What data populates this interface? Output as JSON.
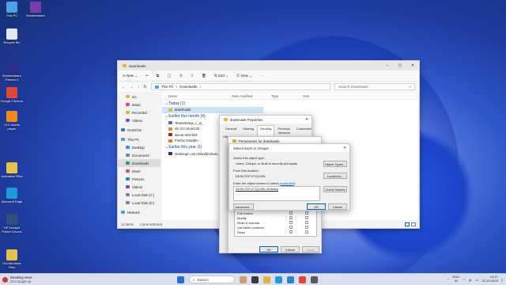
{
  "desktop": {
    "icons": [
      {
        "label": "This PC",
        "color": "#4d9fe8"
      },
      {
        "label": "Recycle Bin",
        "color": "#dfe8f3"
      },
      {
        "label": "Wondershare Filmora X",
        "color": "#2d2d8c"
      },
      {
        "label": "Google Chrome",
        "color": "#e2463b"
      },
      {
        "label": "VLC media player",
        "color": "#f08a1c"
      },
      {
        "label": "Activation Files",
        "color": "#e7c24a"
      },
      {
        "label": "Microsoft Edge",
        "color": "#1d9bd8"
      },
      {
        "label": "HP Deskjet Printer Drivers",
        "color": "#305080"
      },
      {
        "label": "Old Windows Files",
        "color": "#e7c24a"
      },
      {
        "label": "Wondershare",
        "color": "#7a3db0"
      }
    ]
  },
  "explorer": {
    "title": "downloads",
    "new_label": "New",
    "sort_label": "Sort",
    "view_label": "View",
    "breadcrumb": [
      "This PC",
      "Downloads"
    ],
    "search_placeholder": "Search Downloads",
    "columns": [
      "Name",
      "Date modified",
      "Type",
      "Size"
    ],
    "nav": [
      {
        "label": "etc",
        "icon": "#e2b341"
      },
      {
        "label": "Music",
        "icon": "#e0457b"
      },
      {
        "label": "Recorded",
        "icon": "#e2b341"
      },
      {
        "label": "Videos",
        "icon": "#7d4ad6"
      },
      {
        "label": "OneDrive",
        "icon": "#2e7dd7"
      },
      {
        "label": "This PC",
        "icon": "#4d9fe8"
      },
      {
        "label": "Desktop",
        "icon": "#3a8ee6"
      },
      {
        "label": "Documents",
        "icon": "#6f8aa8"
      },
      {
        "label": "Downloads",
        "icon": "#2f9b54"
      },
      {
        "label": "Music",
        "icon": "#e0457b"
      },
      {
        "label": "Pictures",
        "icon": "#2e7dd7"
      },
      {
        "label": "Videos",
        "icon": "#7d4ad6"
      },
      {
        "label": "Local Disk (C:)",
        "icon": "#7a8699"
      },
      {
        "label": "Local Disk (D:)",
        "icon": "#7a8699"
      },
      {
        "label": "Network",
        "icon": "#4d9fe8"
      }
    ],
    "groups": [
      {
        "title": "Today (1)",
        "files": [
          {
            "name": "downloads",
            "icon": "#e2b341",
            "selected": true
          }
        ]
      },
      {
        "title": "Earlier this month (4)",
        "files": [
          {
            "name": "TeamsSetup_c_w_",
            "icon": "#5b5fc7"
          },
          {
            "name": "vlc-3.0.19-win32",
            "icon": "#f08a1c"
          },
          {
            "name": "winrar-x64-624",
            "icon": "#8c2f2f"
          },
          {
            "name": "Firefox Installer",
            "icon": "#e8762b"
          }
        ]
      },
      {
        "title": "Earlier this year (1)",
        "files": [
          {
            "name": "Getintopc.com.Wondershare_Filmora",
            "icon": "#2d2d8c"
          }
        ]
      }
    ],
    "status": [
      "14 items",
      "1 item selected"
    ]
  },
  "properties": {
    "title": "downloads Properties",
    "tabs": [
      "General",
      "Sharing",
      "Security",
      "Previous Versions",
      "Customize"
    ],
    "active_tab": "Security",
    "peek_label": "Obj"
  },
  "permissions": {
    "title": "Permissions for downloads",
    "rows": [
      "Full control",
      "Modify",
      "Read & execute",
      "List folder contents",
      "Read"
    ],
    "ok": "OK",
    "cancel": "Cancel",
    "apply": "Apply"
  },
  "select_users": {
    "title": "Select Users or Groups",
    "object_type_label": "Select this object type:",
    "object_type_value": "Users, Groups, or Built-in security principals",
    "object_types_button": "Object Types...",
    "location_label": "From this location:",
    "location_value": "DESKTOP-ETQC8SL",
    "locations_button": "Locations...",
    "names_label_pre": "Enter the object names to select (",
    "names_label_link": "examples",
    "names_label_post": "):",
    "names_value": "DESKTOP-ETQC8SL\\Keithley",
    "check_names_button": "Check Names",
    "advanced_button": "Advanced...",
    "ok": "OK",
    "cancel": "Cancel"
  },
  "taskbar": {
    "news_title": "Breaking news",
    "news_sub": "Get caught up",
    "search_placeholder": "Search",
    "lang": "ENG",
    "region": "IN",
    "time": "14:47",
    "date": "23-10-2023"
  }
}
